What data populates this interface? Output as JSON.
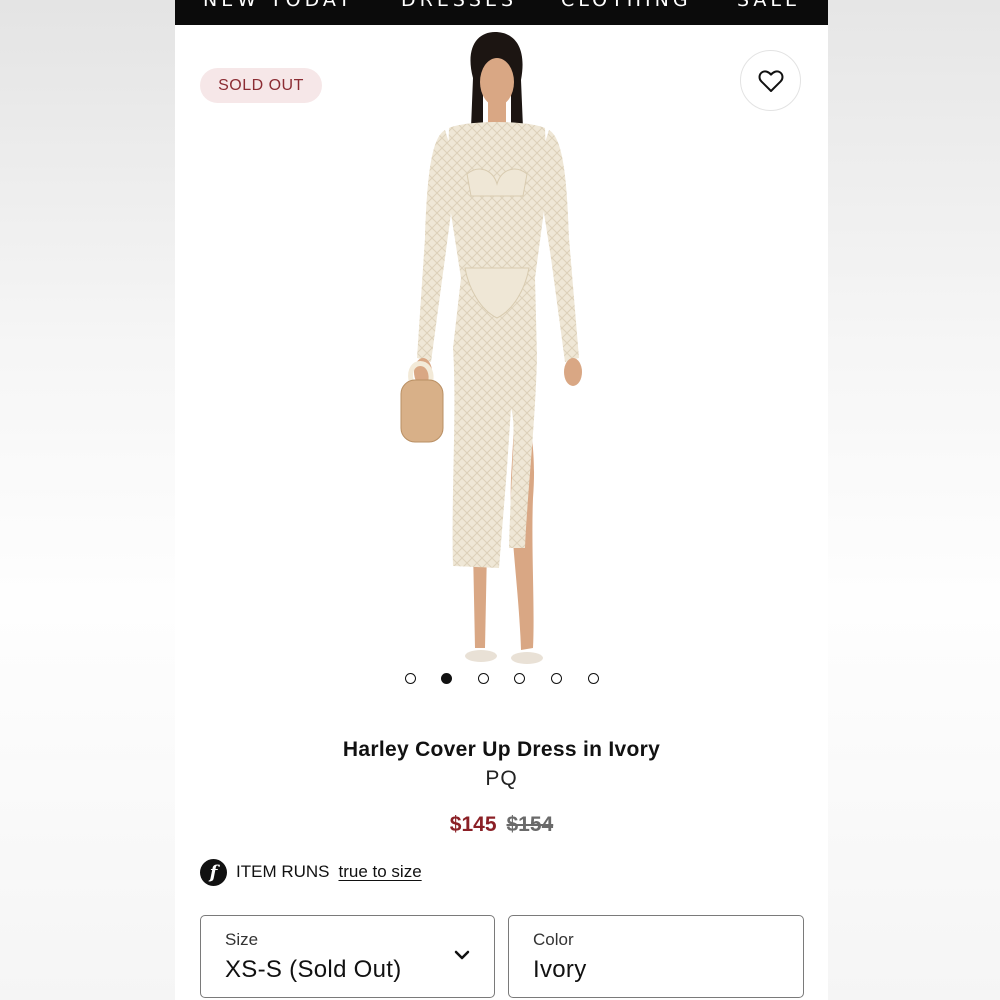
{
  "nav": {
    "items": [
      "NEW TODAY",
      "DRESSES",
      "CLOTHING",
      "SALE"
    ]
  },
  "badge": {
    "label": "SOLD OUT"
  },
  "gallery": {
    "image_count": 6,
    "active_index": 1
  },
  "product": {
    "title": "Harley Cover Up Dress in Ivory",
    "brand": "PQ",
    "price_sale": "$145",
    "price_original": "$154"
  },
  "fit": {
    "icon_letter": "f",
    "label": "ITEM RUNS",
    "link": "true to size"
  },
  "options": {
    "size": {
      "label": "Size",
      "value": "XS-S (Sold Out)"
    },
    "color": {
      "label": "Color",
      "value": "Ivory"
    }
  },
  "colors": {
    "nav_bg": "#0b0b0b",
    "badge_bg": "#f6e7e8",
    "badge_text": "#8b2c33",
    "sale_price": "#8b2026",
    "dress": "#efe7d6",
    "skin": "#d9a784"
  },
  "icons": {
    "wishlist": "heart-outline-icon",
    "dropdown": "chevron-down-icon",
    "fit": "fit-predictor-icon"
  }
}
